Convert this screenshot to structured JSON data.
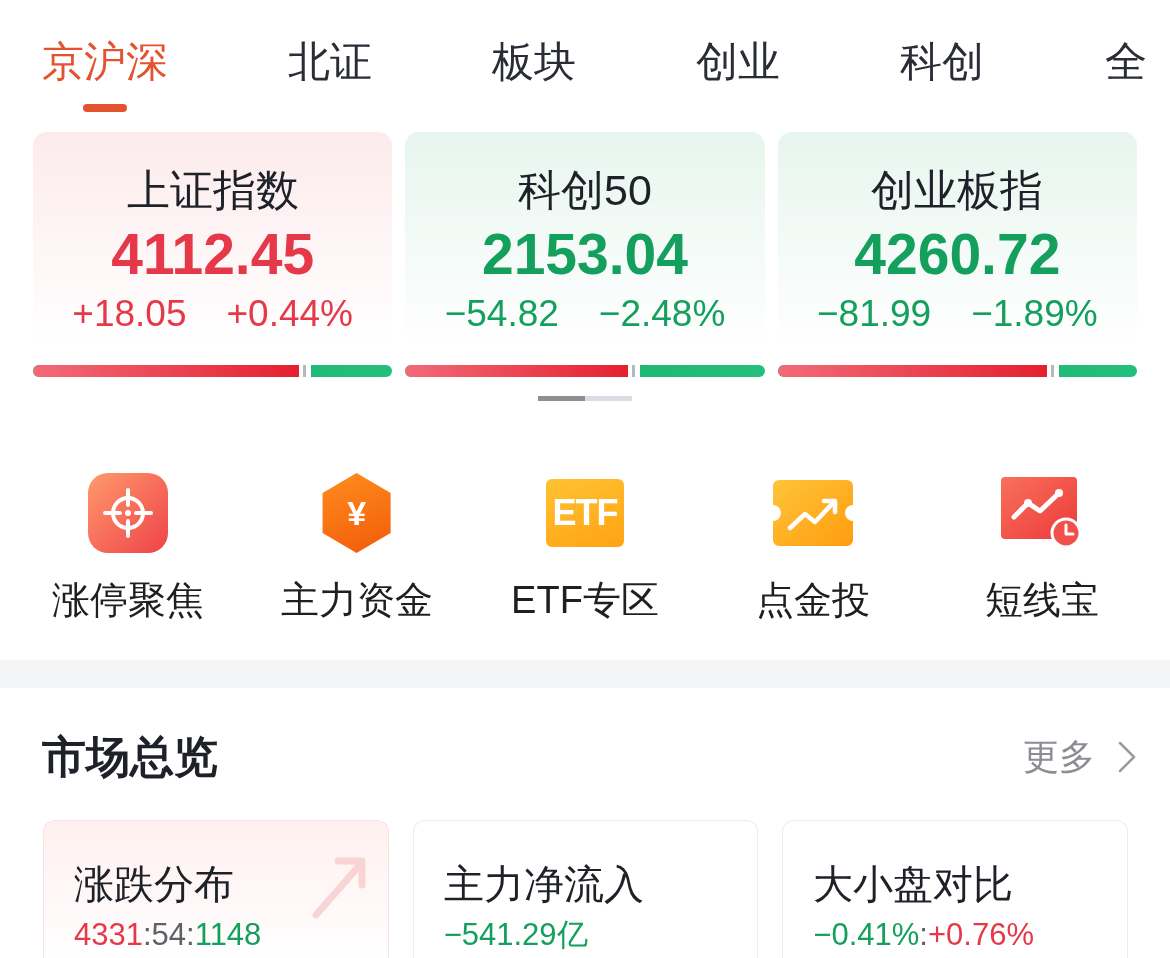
{
  "tabs": [
    {
      "label": "京沪深",
      "selected": true
    },
    {
      "label": "北证",
      "selected": false
    },
    {
      "label": "板块",
      "selected": false
    },
    {
      "label": "创业",
      "selected": false
    },
    {
      "label": "科创",
      "selected": false
    },
    {
      "label": "全",
      "selected": false
    }
  ],
  "index_cards": [
    {
      "name": "上证指数",
      "value": "4112.45",
      "change": "+18.05",
      "change_percent": "+0.44%",
      "color": "#e5394a",
      "level": 0.74
    },
    {
      "name": "科创50",
      "value": "2153.04",
      "change": "−54.82",
      "change_percent": "−2.48%",
      "color": "#14a05c",
      "level": 0.62
    },
    {
      "name": "创业板指",
      "value": "4260.72",
      "change": "−81.99",
      "change_percent": "−1.89%",
      "color": "#14a05c",
      "level": 0.75
    }
  ],
  "shortcuts": [
    {
      "label": "涨停聚焦"
    },
    {
      "label": "主力资金",
      "icon_text": "¥"
    },
    {
      "label": "ETF专区",
      "icon_text": "ETF"
    },
    {
      "label": "点金投"
    },
    {
      "label": "短线宝"
    }
  ],
  "market_overview": {
    "title": "市场总览",
    "more": "更多",
    "cards": [
      {
        "title": "涨跌分布",
        "highlighted": true,
        "parts": [
          {
            "text": "4331",
            "color": "#e5394a"
          },
          {
            "text": ":54:",
            "color": "#5e6068"
          },
          {
            "text": "1148",
            "color": "#14a05c"
          }
        ]
      },
      {
        "title": "主力净流入",
        "highlighted": false,
        "parts": [
          {
            "text": "−541.29亿",
            "color": "#14a05c"
          }
        ]
      },
      {
        "title": "大小盘对比",
        "highlighted": false,
        "parts": [
          {
            "text": "−0.41%",
            "color": "#14a05c"
          },
          {
            "text": ":",
            "color": "#5e6068"
          },
          {
            "text": "+0.76%",
            "color": "#e5394a"
          }
        ]
      }
    ]
  }
}
